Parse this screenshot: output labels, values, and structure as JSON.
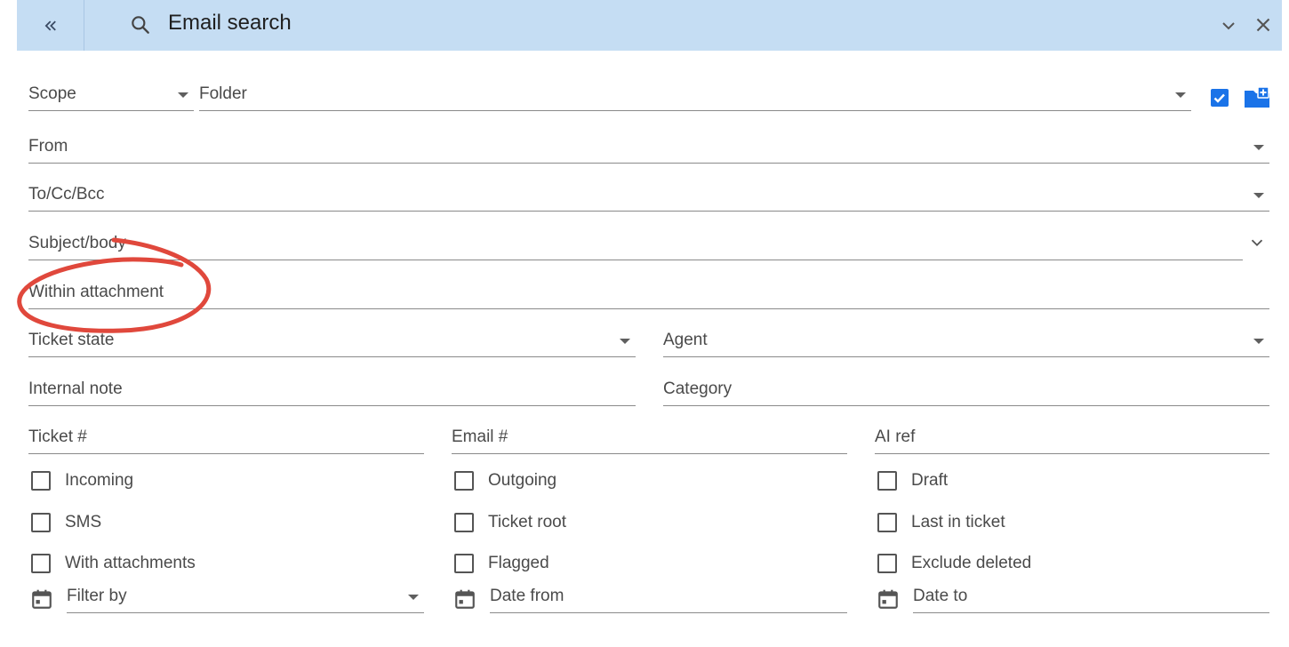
{
  "header": {
    "title": "Email search",
    "collapse_icon": "double-chevron-left-icon",
    "search_icon": "search-icon",
    "expand_icon": "chevron-down-icon",
    "close_icon": "close-icon",
    "background": "#c5ddf3"
  },
  "fields": {
    "scope": "Scope",
    "folder": "Folder",
    "from": "From",
    "to_cc_bcc": "To/Cc/Bcc",
    "subject_body": "Subject/body",
    "within_attachment": "Within attachment",
    "ticket_state": "Ticket state",
    "agent": "Agent",
    "internal_note": "Internal note",
    "category": "Category",
    "ticket_no": "Ticket #",
    "email_no": "Email #",
    "ai_ref": "AI ref",
    "filter_by": "Filter by",
    "date_from": "Date from",
    "date_to": "Date to"
  },
  "folder_options": {
    "include_subfolders_checked": true,
    "checkbox_icon": "checked-checkbox-icon",
    "add_folder_icon": "add-folder-icon"
  },
  "checkboxes": {
    "incoming": "Incoming",
    "outgoing": "Outgoing",
    "draft": "Draft",
    "sms": "SMS",
    "ticket_root": "Ticket root",
    "last_in_ticket": "Last in ticket",
    "with_attachments": "With attachments",
    "flagged": "Flagged",
    "exclude_deleted": "Exclude deleted"
  },
  "colors": {
    "accent": "#1a73e8",
    "annotation": "#e0483c"
  }
}
